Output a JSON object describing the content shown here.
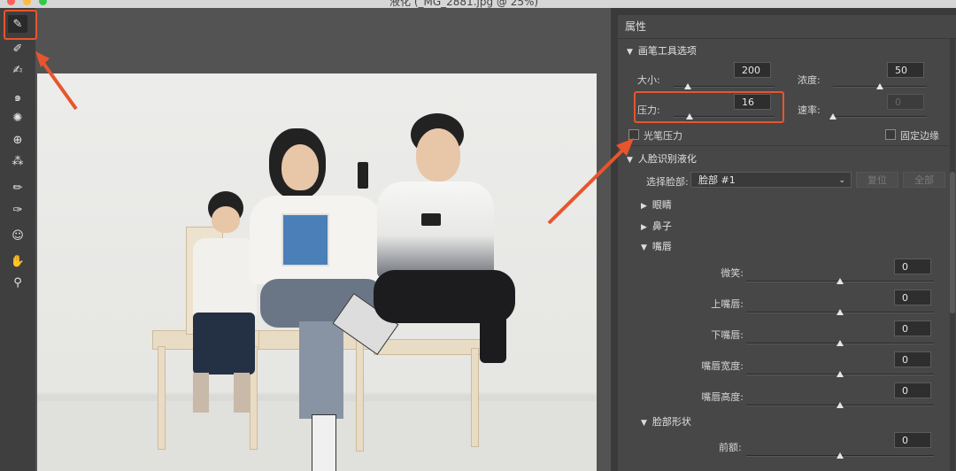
{
  "window": {
    "title": "液化 (_MG_2881.jpg @ 25%)"
  },
  "toolbar": {
    "tools": [
      {
        "name": "forward-warp-tool-icon",
        "glyph": "✎",
        "active": true
      },
      {
        "name": "reconstruct-tool-icon",
        "glyph": "✐"
      },
      {
        "name": "smooth-tool-icon",
        "glyph": "✍"
      },
      {
        "name": "twirl-tool-icon",
        "glyph": "๑"
      },
      {
        "name": "pucker-tool-icon",
        "glyph": "✺"
      },
      {
        "name": "bloat-tool-icon",
        "glyph": "⊕"
      },
      {
        "name": "push-left-tool-icon",
        "glyph": "⁂"
      },
      {
        "name": "freeze-mask-tool-icon",
        "glyph": "✏"
      },
      {
        "name": "thaw-mask-tool-icon",
        "glyph": "✑"
      },
      {
        "name": "face-tool-icon",
        "glyph": "☺"
      },
      {
        "name": "hand-tool-icon",
        "glyph": "✋"
      },
      {
        "name": "zoom-tool-icon",
        "glyph": "⚲"
      }
    ]
  },
  "panel": {
    "title": "属性",
    "brush_section": "画笔工具选项",
    "size": {
      "label": "大小:",
      "value": "200",
      "level": 0.14
    },
    "density": {
      "label": "浓度:",
      "value": "50",
      "level": 0.5
    },
    "pressure": {
      "label": "压力:",
      "value": "16",
      "level": 0.16
    },
    "rate": {
      "label": "速率:",
      "value": "0",
      "level": 0.0
    },
    "stylus_pressure": "光笔压力",
    "pin_edges": "固定边缘",
    "face_section": "人脸识别液化",
    "select_face_label": "选择脸部:",
    "select_face_value": "脸部 #1",
    "reset_button": "复位",
    "all_button": "全部",
    "eyes": "眼睛",
    "nose": "鼻子",
    "mouth": "嘴唇",
    "mouth_items": [
      {
        "label": "微笑:",
        "value": "0"
      },
      {
        "label": "上嘴唇:",
        "value": "0"
      },
      {
        "label": "下嘴唇:",
        "value": "0"
      },
      {
        "label": "嘴唇宽度:",
        "value": "0"
      },
      {
        "label": "嘴唇高度:",
        "value": "0"
      }
    ],
    "face_shape": "脸部形状",
    "forehead": {
      "label": "前额:",
      "value": "0"
    }
  },
  "colors": {
    "highlight": "#e8552c",
    "panel": "#474747",
    "canvas": "#535353"
  }
}
